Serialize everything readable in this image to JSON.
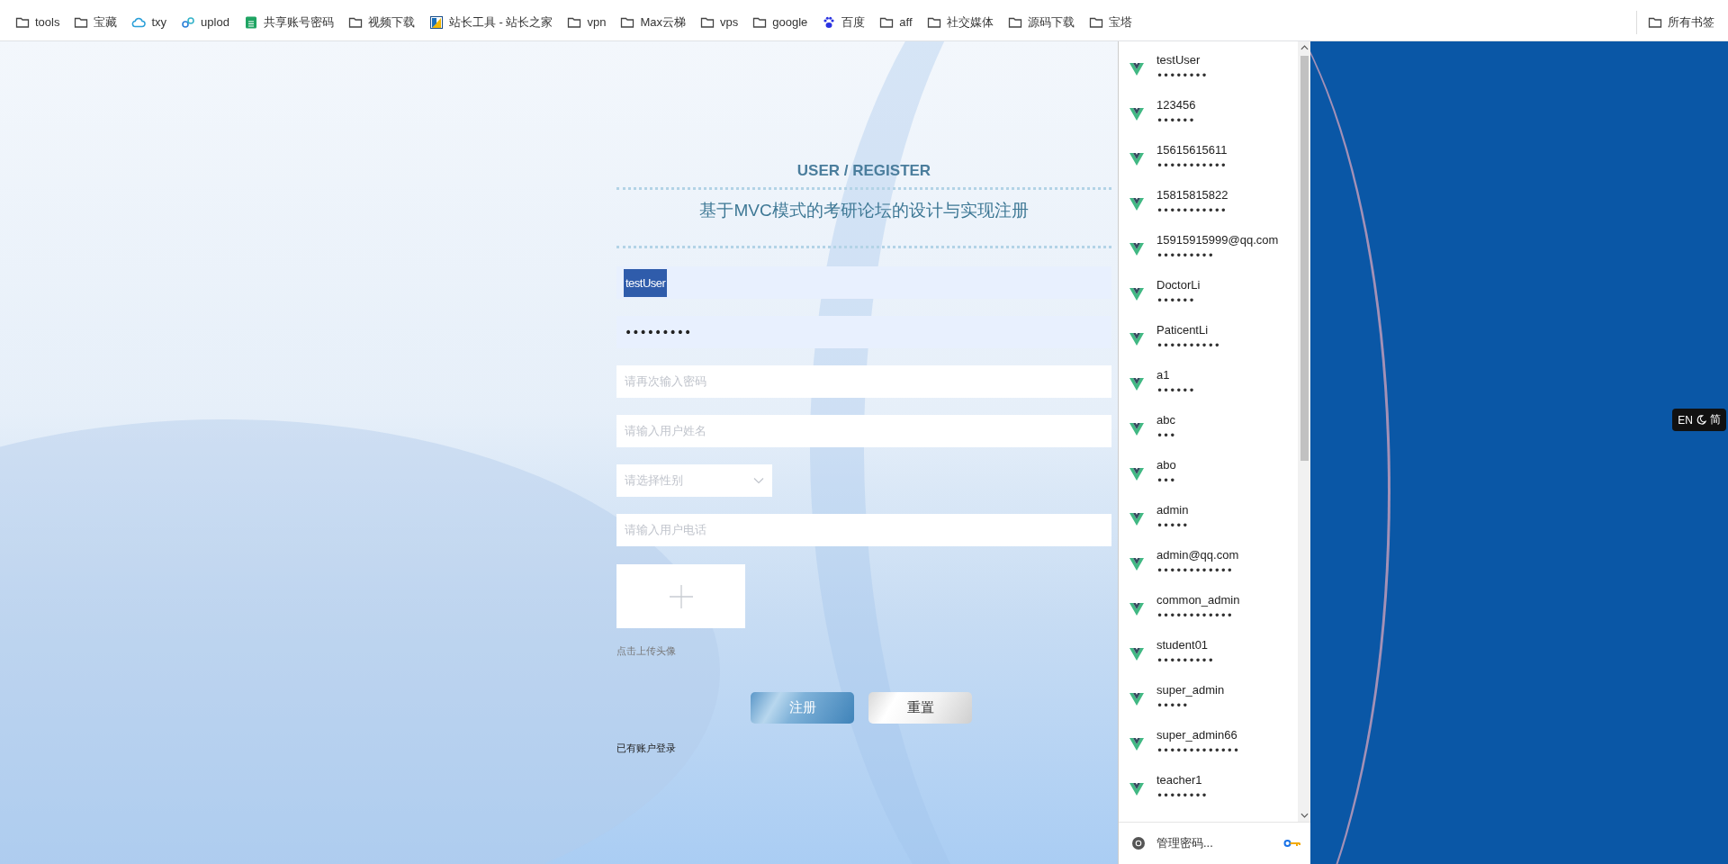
{
  "bookmarks": [
    {
      "kind": "folder",
      "label": "tools"
    },
    {
      "kind": "folder",
      "label": "宝藏"
    },
    {
      "kind": "cloud",
      "label": "txy"
    },
    {
      "kind": "link",
      "label": "uplod"
    },
    {
      "kind": "sheet",
      "label": "共享账号密码"
    },
    {
      "kind": "folder",
      "label": "视频下载"
    },
    {
      "kind": "tile",
      "label": "站长工具 - 站长之家"
    },
    {
      "kind": "folder",
      "label": "vpn"
    },
    {
      "kind": "folder",
      "label": "Max云梯"
    },
    {
      "kind": "folder",
      "label": "vps"
    },
    {
      "kind": "folder",
      "label": "google"
    },
    {
      "kind": "paw",
      "label": "百度"
    },
    {
      "kind": "folder",
      "label": "aff"
    },
    {
      "kind": "folder",
      "label": "社交媒体"
    },
    {
      "kind": "folder",
      "label": "源码下载"
    },
    {
      "kind": "folder",
      "label": "宝塔"
    }
  ],
  "all_bookmarks": {
    "label": "所有书签"
  },
  "form": {
    "heading": "USER / REGISTER",
    "title": "基于MVC模式的考研论坛的设计与实现注册",
    "fields": [
      {
        "kind": "text",
        "value": "testUser",
        "autofilled": true
      },
      {
        "kind": "password",
        "value": "•••••••••",
        "autofilled": true
      },
      {
        "kind": "text",
        "placeholder": "请再次输入密码"
      },
      {
        "kind": "text",
        "placeholder": "请输入用户姓名"
      },
      {
        "kind": "select",
        "placeholder": "请选择性别"
      },
      {
        "kind": "text",
        "placeholder": "请输入用户电话"
      }
    ],
    "upload_hint": "点击上传头像",
    "buttons": [
      {
        "kind": "primary",
        "label": "注册"
      },
      {
        "kind": "secondary",
        "label": "重置"
      }
    ],
    "login_link": "已有账户登录"
  },
  "password_popup": {
    "accounts": [
      {
        "username": "testUser",
        "password": "••••••••"
      },
      {
        "username": "123456",
        "password": "••••••"
      },
      {
        "username": "15615615611",
        "password": "•••••••••••"
      },
      {
        "username": "15815815822",
        "password": "•••••••••••"
      },
      {
        "username": "15915915999@qq.com",
        "password": "•••••••••"
      },
      {
        "username": "DoctorLi",
        "password": "••••••"
      },
      {
        "username": "PaticentLi",
        "password": "••••••••••"
      },
      {
        "username": "a1",
        "password": "••••••"
      },
      {
        "username": "abc",
        "password": "•••"
      },
      {
        "username": "abo",
        "password": "•••"
      },
      {
        "username": "admin",
        "password": "•••••"
      },
      {
        "username": "admin@qq.com",
        "password": "••••••••••••"
      },
      {
        "username": "common_admin",
        "password": "••••••••••••"
      },
      {
        "username": "student01",
        "password": "•••••••••"
      },
      {
        "username": "super_admin",
        "password": "•••••"
      },
      {
        "username": "super_admin66",
        "password": "•••••••••••••"
      },
      {
        "username": "teacher1",
        "password": "••••••••"
      }
    ],
    "manage": "管理密码..."
  },
  "language_badge": {
    "left": "EN",
    "right": "简"
  }
}
